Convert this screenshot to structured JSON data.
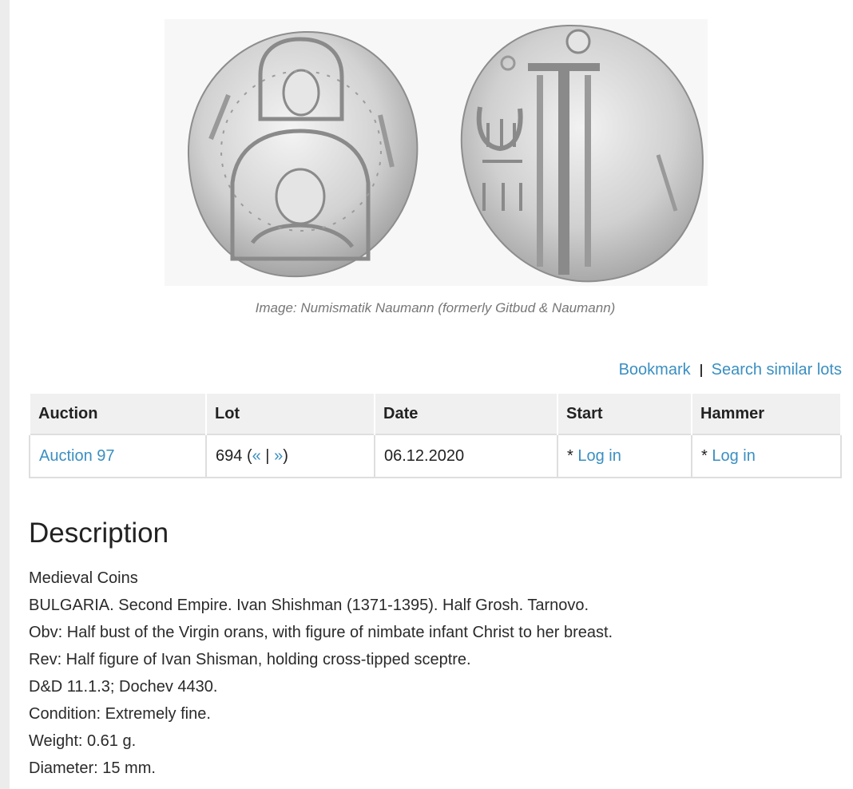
{
  "image": {
    "alt": "Coin obverse and reverse",
    "caption": "Image: Numismatik Naumann (formerly Gitbud & Naumann)"
  },
  "actions": {
    "bookmark": "Bookmark",
    "separator": "I",
    "search_similar": "Search similar lots"
  },
  "lot_table": {
    "headers": [
      "Auction",
      "Lot",
      "Date",
      "Start",
      "Hammer"
    ],
    "row": {
      "auction": "Auction 97",
      "lot_number": "694",
      "lot_open": "(",
      "lot_prev": "«",
      "lot_sep": "|",
      "lot_next": "»",
      "lot_close": ")",
      "date": "06.12.2020",
      "start_prefix": "*",
      "start_link": "Log in",
      "hammer_prefix": "*",
      "hammer_link": "Log in"
    }
  },
  "description": {
    "title": "Description",
    "lines": [
      "Medieval Coins",
      "BULGARIA. Second Empire. Ivan Shishman (1371-1395). Half Grosh. Tarnovo.",
      "Obv: Half bust of the Virgin orans, with figure of nimbate infant Christ to her breast.",
      "Rev: Half figure of Ivan Shisman, holding cross-tipped sceptre.",
      "D&D 11.1.3; Dochev 4430.",
      "Condition: Extremely fine.",
      "Weight: 0.61 g.",
      "Diameter: 15 mm."
    ]
  },
  "colors": {
    "link": "#3a8fc2",
    "table_header_bg": "#f0f0f0",
    "coin_silver": "#c9c9c9"
  }
}
